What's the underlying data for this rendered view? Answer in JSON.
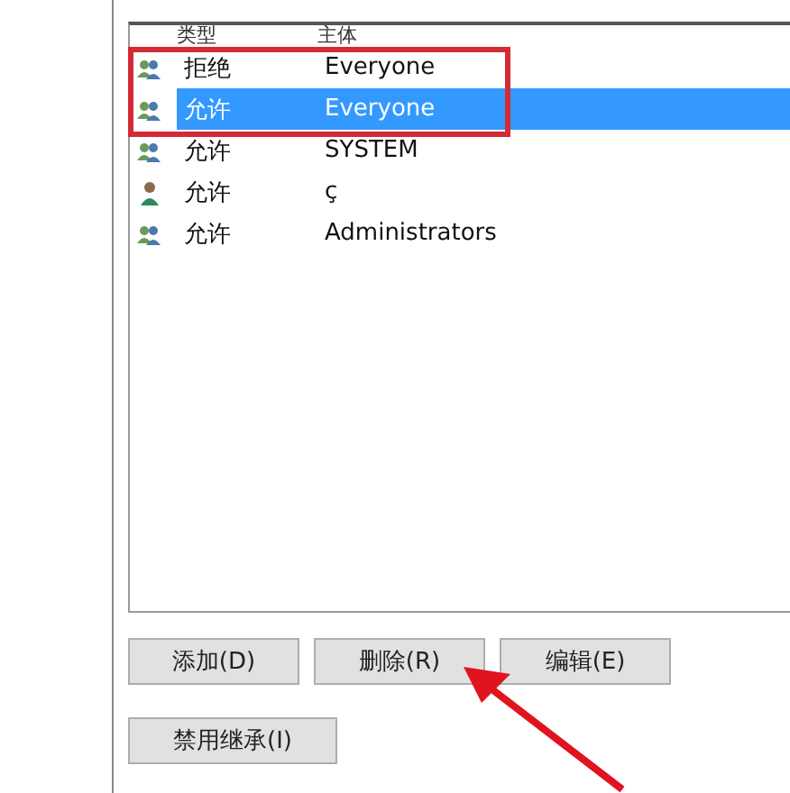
{
  "table": {
    "columns": [
      "类型",
      "主体"
    ],
    "rows": [
      {
        "type": "拒绝",
        "principal": "Everyone",
        "kind": "group",
        "selected": false
      },
      {
        "type": "允许",
        "principal": "Everyone",
        "kind": "group",
        "selected": true
      },
      {
        "type": "允许",
        "principal": "SYSTEM",
        "kind": "group",
        "selected": false
      },
      {
        "type": "允许",
        "principal": "ç",
        "kind": "user",
        "selected": false
      },
      {
        "type": "允许",
        "principal": "Administrators",
        "kind": "group",
        "selected": false
      }
    ]
  },
  "buttons": [
    [
      "添加(D)",
      "删除(R)",
      "编辑(E)"
    ],
    [
      "禁用继承(I)"
    ]
  ]
}
